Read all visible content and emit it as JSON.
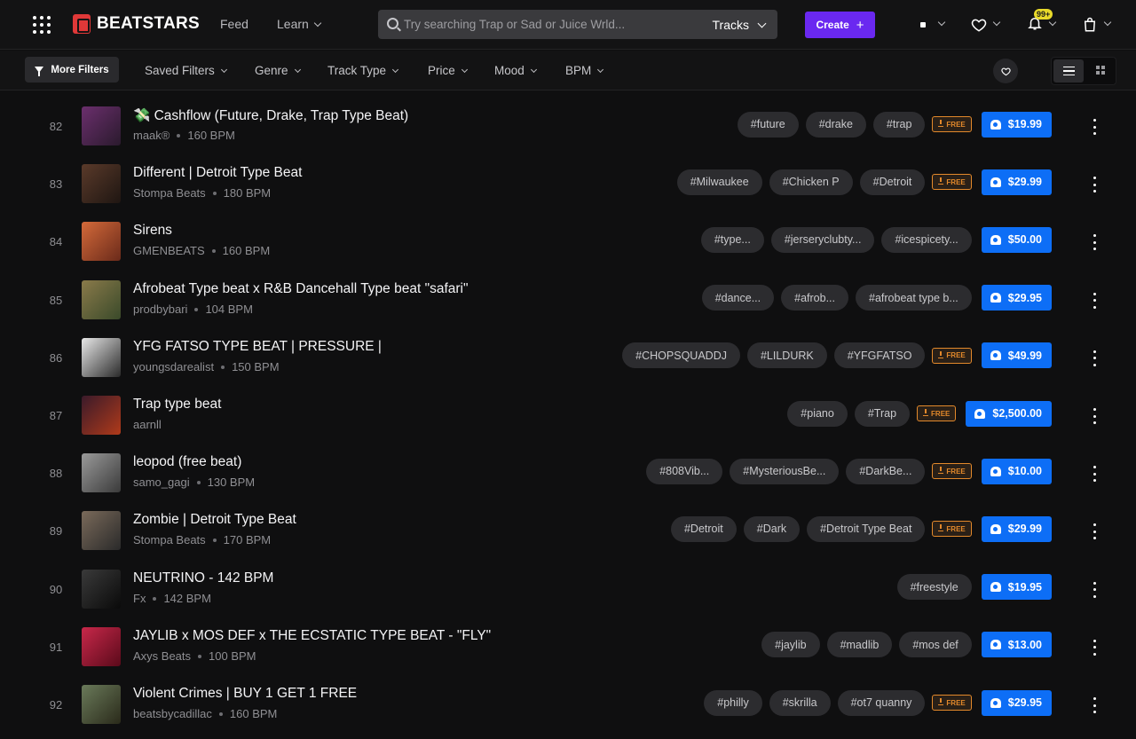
{
  "header": {
    "brand": "BEATSTARS",
    "nav": {
      "feed": "Feed",
      "learn": "Learn"
    },
    "search": {
      "placeholder": "Try searching Trap or Sad or Juice Wrld...",
      "type": "Tracks"
    },
    "create": "Create",
    "notifications_badge": "99+"
  },
  "filters": {
    "more": "More Filters",
    "items": [
      "Saved Filters",
      "Genre",
      "Track Type",
      "Price",
      "Mood",
      "BPM"
    ]
  },
  "tracks": [
    {
      "num": "82",
      "title": "💸 Cashflow (Future, Drake, Trap Type Beat)",
      "producer": "maak®",
      "bpm": "160 BPM",
      "tags": [
        "#future",
        "#drake",
        "#trap"
      ],
      "free": true,
      "price": "$19.99",
      "thumb": [
        "#6b2f6d",
        "#2a1a2d"
      ]
    },
    {
      "num": "83",
      "title": "Different | Detroit Type Beat",
      "producer": "Stompa Beats",
      "bpm": "180 BPM",
      "tags": [
        "#Milwaukee",
        "#Chicken P",
        "#Detroit"
      ],
      "free": true,
      "price": "$29.99",
      "thumb": [
        "#5a3a2a",
        "#1f1612"
      ]
    },
    {
      "num": "84",
      "title": "Sirens",
      "producer": "GMENBEATS",
      "bpm": "160 BPM",
      "tags": [
        "#type...",
        "#jerseryclubty...",
        "#icespicety..."
      ],
      "free": false,
      "price": "$50.00",
      "thumb": [
        "#d46a3a",
        "#6a2a1a"
      ]
    },
    {
      "num": "85",
      "title": "Afrobeat Type beat x R&B Dancehall Type beat \"safari\"",
      "producer": "prodbybari",
      "bpm": "104 BPM",
      "tags": [
        "#dance...",
        "#afrob...",
        "#afrobeat type b..."
      ],
      "free": false,
      "price": "$29.95",
      "thumb": [
        "#8a7a4a",
        "#3a4a2a"
      ]
    },
    {
      "num": "86",
      "title": "YFG FATSO TYPE BEAT | PRESSURE |",
      "producer": "youngsdarealist",
      "bpm": "150 BPM",
      "tags": [
        "#CHOPSQUADDJ",
        "#LILDURK",
        "#YFGFATSO"
      ],
      "free": true,
      "price": "$49.99",
      "thumb": [
        "#e8e8e8",
        "#2a2a2a"
      ]
    },
    {
      "num": "87",
      "title": "Trap type beat",
      "producer": "aarnll",
      "bpm": "",
      "tags": [
        "#piano",
        "#Trap"
      ],
      "free": true,
      "price": "$2,500.00",
      "thumb": [
        "#3a1a2a",
        "#b03a1a"
      ]
    },
    {
      "num": "88",
      "title": "leopod (free beat)",
      "producer": "samo_gagi",
      "bpm": "130 BPM",
      "tags": [
        "#808Vib...",
        "#MysteriousBe...",
        "#DarkBe..."
      ],
      "free": true,
      "price": "$10.00",
      "thumb": [
        "#9a9a9a",
        "#3a3a3a"
      ]
    },
    {
      "num": "89",
      "title": "Zombie | Detroit Type Beat",
      "producer": "Stompa Beats",
      "bpm": "170 BPM",
      "tags": [
        "#Detroit",
        "#Dark",
        "#Detroit Type Beat"
      ],
      "free": true,
      "price": "$29.99",
      "thumb": [
        "#7a6a5a",
        "#2a2a2a"
      ]
    },
    {
      "num": "90",
      "title": "NEUTRINO - 142 BPM",
      "producer": "Fx",
      "bpm": "142 BPM",
      "tags": [
        "#freestyle"
      ],
      "free": false,
      "price": "$19.95",
      "thumb": [
        "#3a3a3a",
        "#0a0a0a"
      ]
    },
    {
      "num": "91",
      "title": "JAYLIB x MOS DEF x THE ECSTATIC TYPE BEAT - \"FLY\"",
      "producer": "Axys Beats",
      "bpm": "100 BPM",
      "tags": [
        "#jaylib",
        "#madlib",
        "#mos def"
      ],
      "free": false,
      "price": "$13.00",
      "thumb": [
        "#c8284a",
        "#5a0a1a"
      ]
    },
    {
      "num": "92",
      "title": "Violent Crimes | BUY 1 GET 1 FREE",
      "producer": "beatsbycadillac",
      "bpm": "160 BPM",
      "tags": [
        "#philly",
        "#skrilla",
        "#ot7 quanny"
      ],
      "free": true,
      "price": "$29.95",
      "thumb": [
        "#6a7a5a",
        "#2a2a1a"
      ]
    }
  ],
  "free_label": "FREE"
}
